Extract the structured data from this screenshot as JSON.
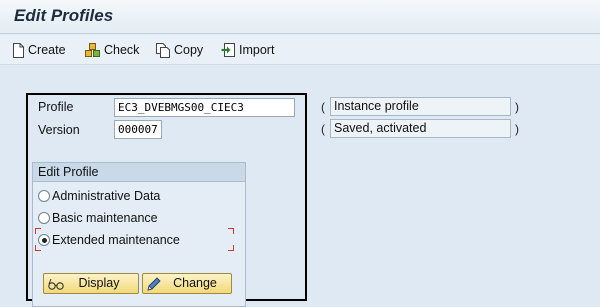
{
  "window": {
    "title": "Edit Profiles"
  },
  "toolbar": {
    "create": {
      "label": "Create",
      "icon": "new-document-icon"
    },
    "check": {
      "label": "Check",
      "icon": "check-blocks-icon"
    },
    "copy": {
      "label": "Copy",
      "icon": "copy-documents-icon"
    },
    "import": {
      "label": "Import",
      "icon": "import-icon"
    }
  },
  "form": {
    "profile": {
      "label": "Profile",
      "value": "EC3_DVEBMGS00_CIEC3",
      "description": "Instance profile"
    },
    "version": {
      "label": "Version",
      "value": "000007",
      "description": "Saved, activated"
    },
    "paren_open": "(",
    "paren_close": ")"
  },
  "edit_profile": {
    "title": "Edit Profile",
    "options": [
      {
        "label": "Administrative Data",
        "selected": false
      },
      {
        "label": "Basic maintenance",
        "selected": false
      },
      {
        "label": "Extended maintenance",
        "selected": true
      }
    ],
    "display_label": "Display",
    "change_label": "Change"
  },
  "colors": {
    "focus_marker": "#d23b2b",
    "action_button": "#f2d97a",
    "groupbox_header": "#c9d9e8"
  }
}
